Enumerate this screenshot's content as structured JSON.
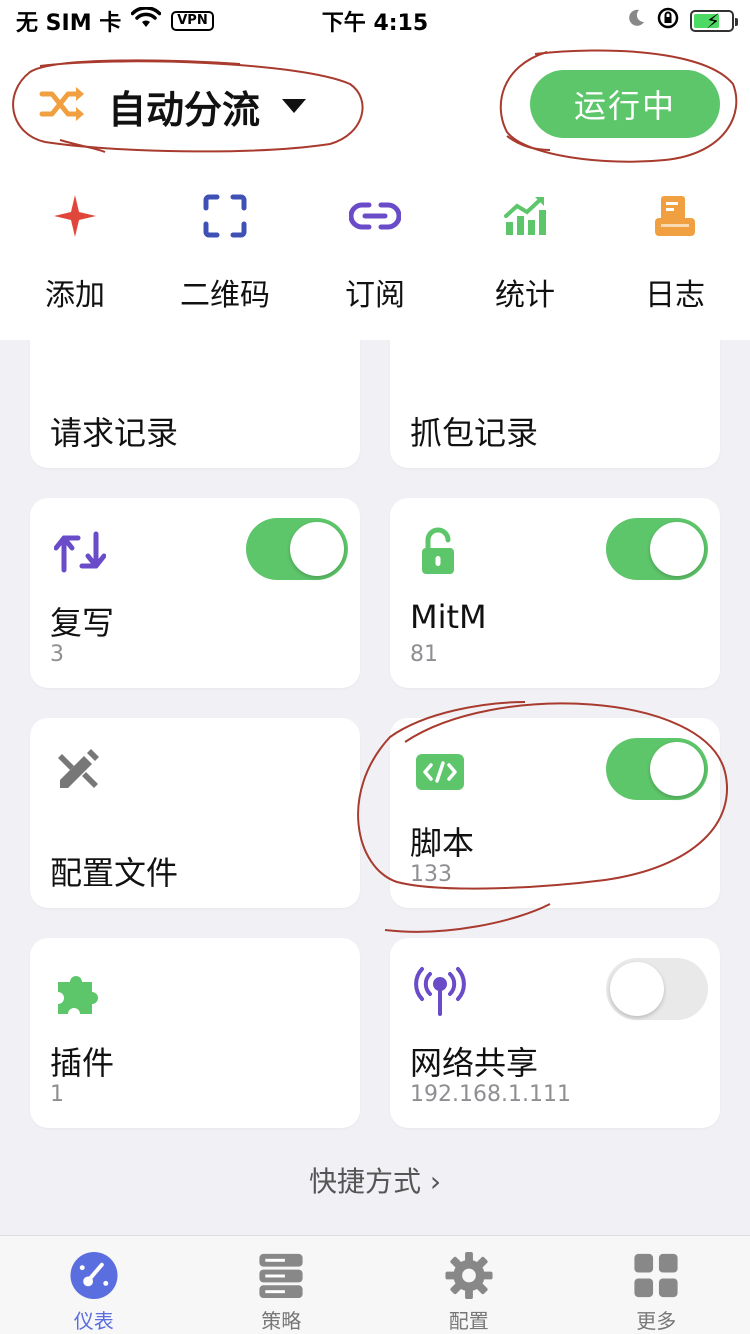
{
  "status_bar": {
    "carrier": "无 SIM 卡",
    "vpn": "VPN",
    "time": "下午 4:15"
  },
  "header": {
    "mode_label": "自动分流",
    "run_status": "运行中",
    "quick_actions": [
      {
        "label": "添加",
        "icon": "plus-icon",
        "color": "#e0473a"
      },
      {
        "label": "二维码",
        "icon": "qr-scan-icon",
        "color": "#3f51b5"
      },
      {
        "label": "订阅",
        "icon": "link-icon",
        "color": "#6a4cc9"
      },
      {
        "label": "统计",
        "icon": "chart-icon",
        "color": "#5ec66a"
      },
      {
        "label": "日志",
        "icon": "log-icon",
        "color": "#f0a040"
      }
    ]
  },
  "cards": {
    "request_log": {
      "title": "请求记录"
    },
    "capture_log": {
      "title": "抓包记录"
    },
    "rewrite": {
      "title": "复写",
      "count": "3",
      "enabled": true
    },
    "mitm": {
      "title": "MitM",
      "count": "81",
      "enabled": true
    },
    "config_file": {
      "title": "配置文件"
    },
    "script": {
      "title": "脚本",
      "count": "133",
      "enabled": true
    },
    "plugin": {
      "title": "插件",
      "count": "1"
    },
    "network_share": {
      "title": "网络共享",
      "address": "192.168.1.111",
      "enabled": false
    }
  },
  "shortcut_link": "快捷方式 ›",
  "tabs": [
    {
      "label": "仪表",
      "icon": "dashboard-icon",
      "active": true
    },
    {
      "label": "策略",
      "icon": "server-icon",
      "active": false
    },
    {
      "label": "配置",
      "icon": "gear-icon",
      "active": false
    },
    {
      "label": "更多",
      "icon": "grid-icon",
      "active": false
    }
  ],
  "colors": {
    "green": "#5ec66a",
    "accent_blue": "#5a6ee0",
    "annotation_red": "#a83a2e"
  }
}
